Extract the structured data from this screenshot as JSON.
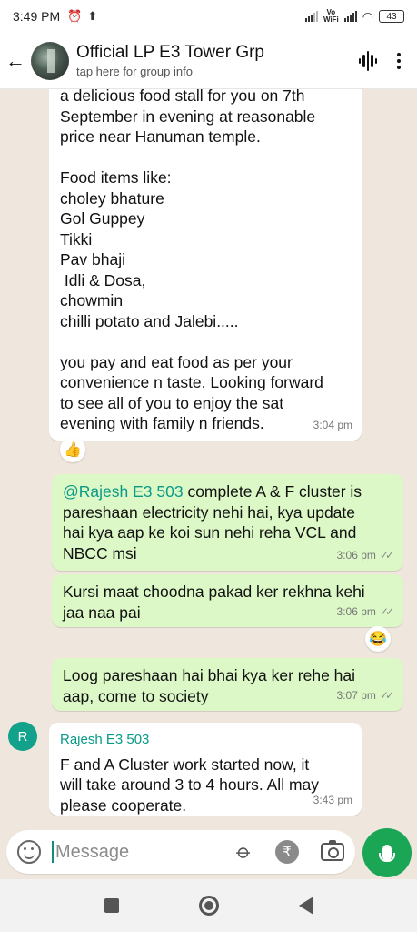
{
  "status_bar": {
    "time": "3:49 PM",
    "vo_wifi": "Vo\nWiFi",
    "battery": "43"
  },
  "header": {
    "title": "Official LP E3 Tower Grp",
    "subtitle": "tap here for group info"
  },
  "messages": [
    {
      "direction": "in",
      "text": "a delicious food stall for you on 7th\nSeptember in evening at reasonable\nprice near Hanuman temple.\n\nFood items like:\ncholey bhature\nGol Guppey\nTikki\nPav bhaji\n Idli & Dosa,\nchowmin\nchilli potato and Jalebi.....\n\nyou pay and eat food as per your\nconvenience n taste. Looking forward\nto see all of you to enjoy the sat\nevening with family n friends.",
      "time": "3:04 pm",
      "reaction": "👍"
    },
    {
      "direction": "out",
      "mention": "@Rajesh E3 503",
      "text": " complete A & F cluster is\npareshaan electricity nehi hai, kya update\nhai kya aap ke koi sun nehi reha VCL and\nNBCC msi",
      "time": "3:06 pm"
    },
    {
      "direction": "out",
      "text": "Kursi maat choodna pakad ker rekhna kehi\njaa naa pai",
      "time": "3:06 pm",
      "reaction": "😂"
    },
    {
      "direction": "out",
      "text": "Loog pareshaan hai bhai kya ker rehe hai\naap, come to society",
      "time": "3:07 pm"
    },
    {
      "direction": "in",
      "avatar": "R",
      "sender": "Rajesh E3 503",
      "text": "F and A Cluster work started now, it\nwill take around 3 to 4 hours. All may\nplease cooperate.",
      "time": "3:43 pm"
    }
  ],
  "composer": {
    "placeholder": "Message",
    "rupee_symbol": "₹"
  },
  "icons": {
    "back": "arrow-left-icon",
    "voice_chat": "audio-wave-icon",
    "menu": "more-vertical-icon",
    "emoji": "smiley-icon",
    "attach": "paperclip-icon",
    "payment": "rupee-icon",
    "camera": "camera-icon",
    "mic": "mic-icon"
  },
  "colors": {
    "outgoing_bubble": "#dcf8c6",
    "incoming_bubble": "#ffffff",
    "accent": "#0a9a87",
    "mic_button": "#1aa655",
    "chat_background": "#efe7dd"
  }
}
